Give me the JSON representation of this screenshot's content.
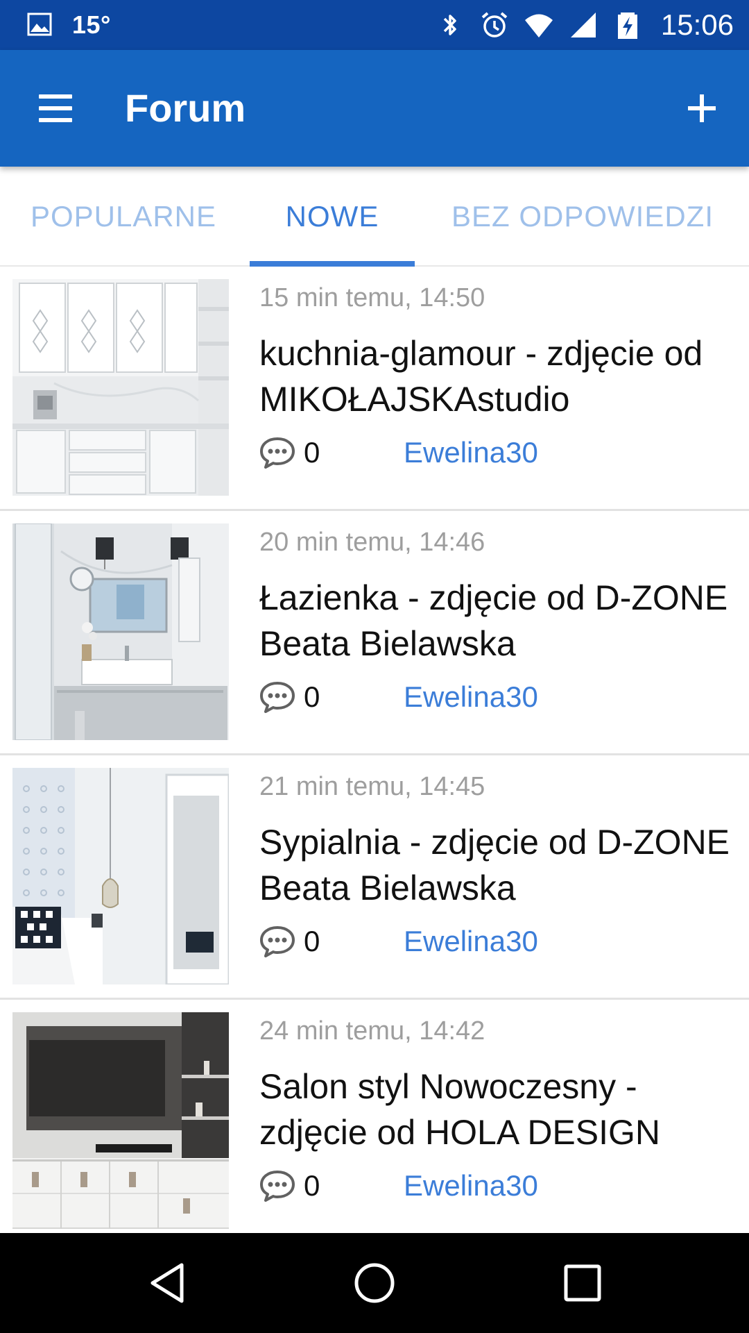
{
  "status_bar": {
    "temperature": "15°",
    "time": "15:06",
    "icons": [
      "image-icon",
      "bluetooth-icon",
      "alarm-icon",
      "wifi-icon",
      "signal-icon",
      "battery-charging-icon"
    ]
  },
  "app_bar": {
    "title": "Forum",
    "menu_icon": "hamburger-menu-icon",
    "add_icon": "plus-icon"
  },
  "tabs": [
    {
      "label": "POPULARNE",
      "active": false
    },
    {
      "label": "NOWE",
      "active": true
    },
    {
      "label": "BEZ ODPOWIEDZI",
      "active": false
    }
  ],
  "posts": [
    {
      "time": "15 min temu, 14:50",
      "title": "kuchnia-glamour - zdjęcie od MIKOŁAJSKAstudio",
      "comments": "0",
      "author": "Ewelina30",
      "thumbnail": "kitchen-photo"
    },
    {
      "time": "20 min temu, 14:46",
      "title": "Łazienka - zdjęcie od D-ZONE Beata Bielawska",
      "comments": "0",
      "author": "Ewelina30",
      "thumbnail": "bathroom-photo"
    },
    {
      "time": "21 min temu, 14:45",
      "title": "Sypialnia - zdjęcie od D-ZONE Beata Bielawska",
      "comments": "0",
      "author": "Ewelina30",
      "thumbnail": "bedroom-photo"
    },
    {
      "time": "24 min temu, 14:42",
      "title": "Salon styl Nowoczesny - zdjęcie od HOLA DESIGN",
      "comments": "0",
      "author": "Ewelina30",
      "thumbnail": "living-room-photo"
    }
  ],
  "nav_bar": {
    "icons": [
      "back-icon",
      "home-icon",
      "recents-icon"
    ]
  },
  "colors": {
    "status_bar": "#0d47a1",
    "app_bar": "#1565c0",
    "accent": "#3b7dd8",
    "inactive_tab": "#9fc0ea"
  }
}
